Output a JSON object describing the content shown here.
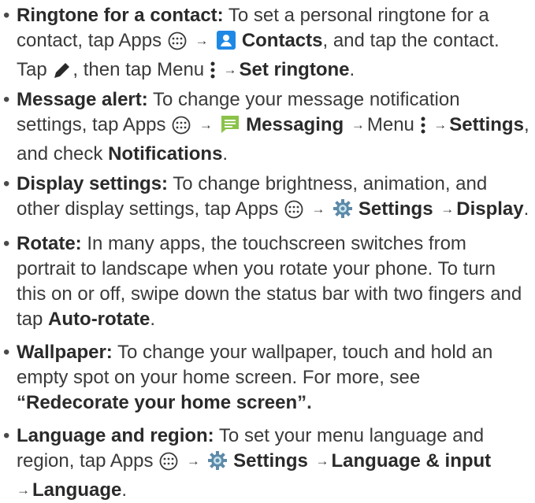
{
  "items": [
    {
      "title": "Ringtone for a contact:",
      "l1": "To set a personal ringtone for a",
      "l2a": "contact, tap Apps",
      "l2b": "Contacts",
      "l2c": ", and tap the contact.",
      "l3a": "Tap",
      "l3b": ", then tap Menu",
      "l3c": "Set ringtone",
      "l3d": "."
    },
    {
      "title": "Message alert:",
      "l1": "To change your message notification",
      "l2a": "settings, tap Apps",
      "l2b": "Messaging",
      "l2c": "Menu",
      "l2d": "Settings",
      "l2e": ",",
      "l3a": "and check",
      "l3b": "Notifications",
      "l3c": "."
    },
    {
      "title": "Display settings:",
      "l1": "To change brightness, animation, and",
      "l2a": "other display settings, tap Apps",
      "l2b": "Settings",
      "l2c": "Display",
      "l2d": "."
    },
    {
      "title": "Rotate:",
      "l1": "In many apps, the touchscreen switches from",
      "l2": "portrait to landscape when you rotate your phone. To turn",
      "l3": "this on or off, swipe down the status bar with two fingers and",
      "l4a": "tap",
      "l4b": "Auto-rotate",
      "l4c": "."
    },
    {
      "title": "Wallpaper:",
      "l1": "To change your wallpaper, touch and hold an",
      "l2": "empty spot on your home screen. For more, see",
      "l3a": "“",
      "l3b": "Redecorate your home screen",
      "l3c": "”."
    },
    {
      "title": "Language and region:",
      "l1": "To set your menu language and",
      "l2a": "region, tap Apps",
      "l2b": "Settings",
      "l2c": "Language & input",
      "l3a": "Language",
      "l3b": "."
    }
  ],
  "glyphs": {
    "bullet": "•",
    "arrow": "→"
  },
  "icons": {
    "apps": "apps-icon",
    "contacts": "contacts-icon",
    "edit": "pencil-icon",
    "menu": "menu-icon",
    "messaging": "messaging-icon",
    "settings": "settings-gear-icon"
  },
  "colors": {
    "text": "#3a3a3a",
    "contacts": "#1e88e5",
    "messaging": "#8bc34a",
    "settings": "#5d8aa8"
  }
}
